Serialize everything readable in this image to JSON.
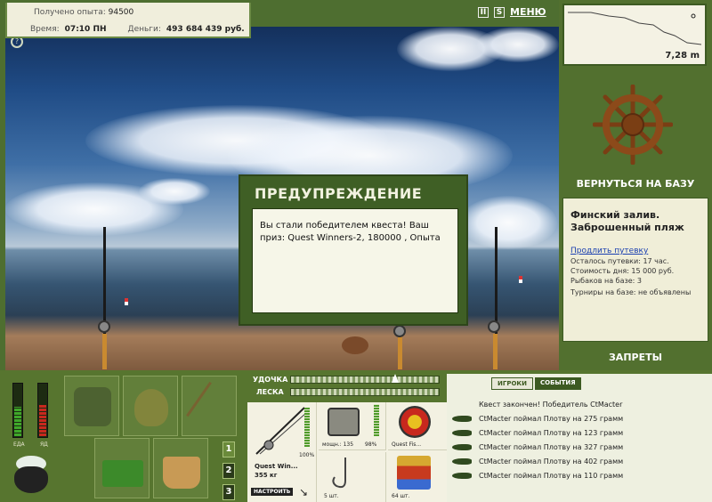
{
  "info": {
    "experience_label": "Получено опыта:",
    "experience_value": "94500",
    "time_label": "Время:",
    "time_value": "07:10 ПН",
    "money_label": "Деньги:",
    "money_value": "493 684 439 руб."
  },
  "toolbar": {
    "pause_label": "II",
    "sound_label": "S",
    "menu_label": "МЕНЮ",
    "help_icon": "help-icon"
  },
  "depth": {
    "value": "7,28 m"
  },
  "right": {
    "return_label": "ВЕРНУТЬСЯ НА БАЗУ",
    "location_title_1": "Финский залив.",
    "location_title_2": "Заброшенный пляж",
    "extend_link": "Продлить путевку",
    "lines": [
      "Осталось путевки: 17 час.",
      "Стоимость дня: 15 000 руб.",
      "Рыбаков на базе: 3",
      "Турниры на базе: не объявлены"
    ],
    "bans_label": "ЗАПРЕТЫ"
  },
  "dialog": {
    "title": "ПРЕДУПРЕЖДЕНИЕ",
    "message": "Вы стали победителем квеста! Ваш приз: Quest Winners-2, 180000 , Опыта"
  },
  "status": {
    "food_label": "ЕДА",
    "food_level": 0.55,
    "poison_label": "ЯД",
    "poison_level": 0.6,
    "food_color": "#3fa82a",
    "poison_color": "#c8281e"
  },
  "inventory": {
    "slot_buttons": [
      "1",
      "2",
      "3"
    ]
  },
  "gear": {
    "rod_label": "УДОЧКА",
    "line_label": "ЛЕСКА",
    "rod_tension": 0.7,
    "rod_name": "Quest Win...",
    "rod_weight": "355 кг",
    "rod_durability": "100%",
    "setup_label": "НАСТРОИТЬ",
    "reel_power": "мощн.: 135",
    "reel_durability": "98%",
    "line_name": "Quest Fis...",
    "hook_count": "5 шт.",
    "bait_count": "64 шт."
  },
  "events": {
    "tabs": [
      "ИГРОКИ",
      "СОБЫТИЯ"
    ],
    "active_tab": 0,
    "items": [
      "Квест закончен! Победитель CtMacter",
      "CtMacter поймал Плотву на 275 грамм",
      "CtMacter поймал Плотву на 123 грамм",
      "CtMacter поймал Плотву на 327 грамм",
      "CtMacter поймал Плотву на 402 грамм",
      "CtMacter поймал Плотву на 110 грамм"
    ]
  }
}
